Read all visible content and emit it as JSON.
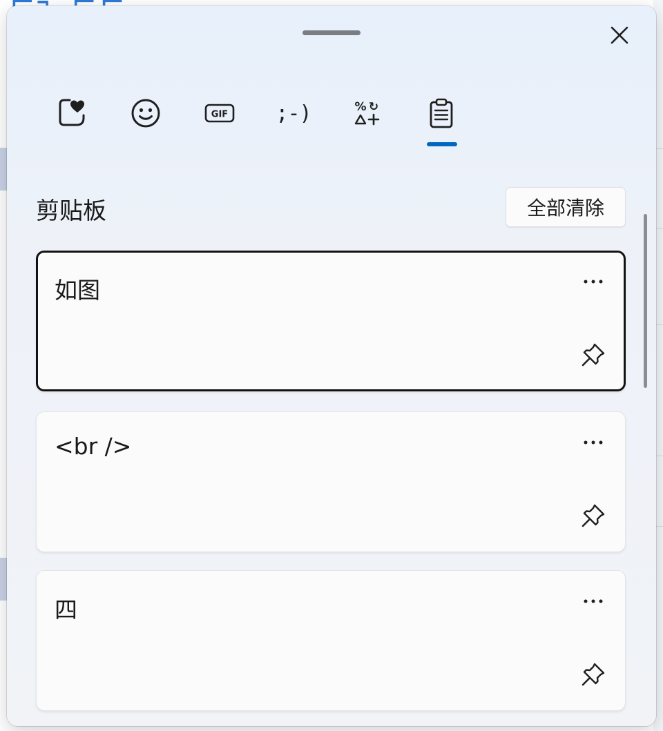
{
  "panel": {
    "close_icon": "close-icon",
    "drag_handle": "drag-handle"
  },
  "tabs": [
    {
      "name": "recently-used",
      "icon": "heart-sticker-icon"
    },
    {
      "name": "emoji",
      "icon": "smiley-icon"
    },
    {
      "name": "gif",
      "icon": "gif-icon",
      "label": "GIF"
    },
    {
      "name": "kaomoji",
      "icon": "kaomoji-icon",
      "label": ";-)"
    },
    {
      "name": "symbols",
      "icon": "symbols-icon"
    },
    {
      "name": "clipboard",
      "icon": "clipboard-icon",
      "selected": true
    }
  ],
  "clipboard": {
    "title": "剪贴板",
    "clear_all_label": "全部清除",
    "items": [
      {
        "text": "如图",
        "selected": true
      },
      {
        "text": "<br />",
        "selected": false
      },
      {
        "text": "四",
        "selected": false
      }
    ]
  },
  "colors": {
    "accent": "#0067c0",
    "selected_border": "#121212"
  }
}
